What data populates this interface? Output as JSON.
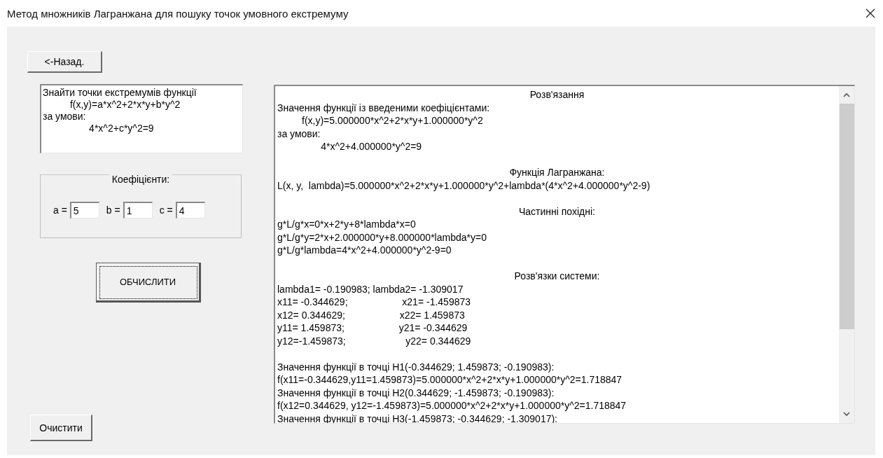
{
  "window": {
    "title": "Метод множників Лагранжана для пошуку точок умовного екстремуму"
  },
  "back_button": "<-Назад.",
  "problem": {
    "lines": [
      "Знайти точки екстремумів функції",
      "          f(x,y)=a*x^2+2*x*y+b*y^2",
      "за умови:",
      "                 4*x^2+c*y^2=9"
    ]
  },
  "coefficients": {
    "title": "Коефіцієнти:",
    "fields": [
      {
        "label": "a =",
        "value": "5"
      },
      {
        "label": "b =",
        "value": "1"
      },
      {
        "label": "c =",
        "value": "4"
      }
    ]
  },
  "calculate_button": {
    "label": "ОБЧИСЛИТИ",
    "focused": true
  },
  "clear_button": "Очистити",
  "solution": {
    "blocks": [
      {
        "heading": "Розв'язання",
        "lines": [
          "Значення функції із введеними коефіцієнтами:",
          "         f(x,y)=5.000000*x^2+2*x*y+1.000000*y^2",
          "за умови:",
          "                4*x^2+4.000000*y^2=9"
        ]
      },
      {
        "heading": "Функція Лагранжана:",
        "lines": [
          "L(x, y,  lambda)=5.000000*x^2+2*x*y+1.000000*y^2+lambda*(4*x^2+4.000000*y^2-9)"
        ]
      },
      {
        "heading": "Частинні похідні:",
        "lines": [
          "g*L/g*x=0*x+2*y+8*lambda*x=0",
          "g*L/g*y=2*x+2.000000*y+8.000000*lambda*y=0",
          "g*L/g*lambda=4*x^2+4.000000*y^2-9=0"
        ]
      },
      {
        "heading": "Розв'язки системи:",
        "lines": [
          "lambda1= -0.190983; lambda2= -1.309017",
          "x11= -0.344629;                    x21= -1.459873",
          "x12= 0.344629;                    x22= 1.459873",
          "y11= 1.459873;                    y21= -0.344629",
          "y12=-1.459873;                      y22= 0.344629"
        ]
      },
      {
        "lines": [
          "Значення функції в точці H1(-0.344629; 1.459873; -0.190983):",
          "f(x11=-0.344629,y11=1.459873)=5.000000*x^2+2*x*y+1.000000*y^2=1.718847",
          "Значення функції в точці H2(0.344629; -1.459873; -0.190983):",
          "f(x12=0.344629, y12=-1.459873)=5.000000*x^2+2*x*y+1.000000*y^2=1.718847",
          "Значення функції в точці H3(-1.459873; -0.344629; -1.309017):"
        ]
      }
    ]
  }
}
